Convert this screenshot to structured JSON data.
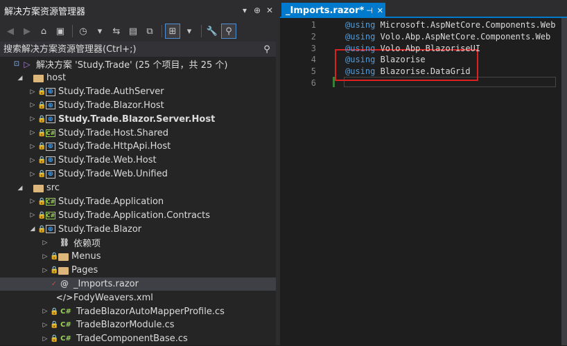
{
  "panel": {
    "title": "解决方案资源管理器",
    "pin_glyph": "▾",
    "pin2_glyph": "⊕",
    "close_glyph": "✕"
  },
  "toolbar": {
    "buttons": [
      "◀",
      "▶",
      "⌂",
      "▣",
      "◷",
      "▾",
      "⇆",
      "▤",
      "⧉",
      "⊞",
      "▾",
      "🔧",
      "⚲"
    ]
  },
  "search": {
    "placeholder": "搜索解决方案资源管理器(Ctrl+;)",
    "icon_glyph": "⚲"
  },
  "tree": [
    {
      "indent": 0,
      "arrow": "",
      "lock": "⊡",
      "icon": "sol",
      "glyph": "▷",
      "label": "解决方案 'Study.Trade' (25 个项目，共 25 个)",
      "bold": false,
      "selected": false
    },
    {
      "indent": 1,
      "arrow": "◢",
      "lock": "",
      "icon": "folder",
      "glyph": "",
      "label": "host",
      "bold": false,
      "selected": false
    },
    {
      "indent": 2,
      "arrow": "▷",
      "lock": "🔒",
      "icon": "web",
      "glyph": "⊕",
      "label": "Study.Trade.AuthServer",
      "bold": false,
      "selected": false
    },
    {
      "indent": 2,
      "arrow": "▷",
      "lock": "🔒",
      "icon": "web",
      "glyph": "⊕",
      "label": "Study.Trade.Blazor.Host",
      "bold": false,
      "selected": false
    },
    {
      "indent": 2,
      "arrow": "▷",
      "lock": "🔒",
      "icon": "web",
      "glyph": "⊕",
      "label": "Study.Trade.Blazor.Server.Host",
      "bold": true,
      "selected": false
    },
    {
      "indent": 2,
      "arrow": "▷",
      "lock": "🔒",
      "icon": "cs",
      "glyph": "C#",
      "label": "Study.Trade.Host.Shared",
      "bold": false,
      "selected": false
    },
    {
      "indent": 2,
      "arrow": "▷",
      "lock": "🔒",
      "icon": "web",
      "glyph": "⊕",
      "label": "Study.Trade.HttpApi.Host",
      "bold": false,
      "selected": false
    },
    {
      "indent": 2,
      "arrow": "▷",
      "lock": "🔒",
      "icon": "web",
      "glyph": "⊕",
      "label": "Study.Trade.Web.Host",
      "bold": false,
      "selected": false
    },
    {
      "indent": 2,
      "arrow": "▷",
      "lock": "🔒",
      "icon": "web",
      "glyph": "⊕",
      "label": "Study.Trade.Web.Unified",
      "bold": false,
      "selected": false
    },
    {
      "indent": 1,
      "arrow": "◢",
      "lock": "",
      "icon": "folder",
      "glyph": "",
      "label": "src",
      "bold": false,
      "selected": false
    },
    {
      "indent": 2,
      "arrow": "▷",
      "lock": "🔒",
      "icon": "cs",
      "glyph": "C#",
      "label": "Study.Trade.Application",
      "bold": false,
      "selected": false
    },
    {
      "indent": 2,
      "arrow": "▷",
      "lock": "🔒",
      "icon": "cs",
      "glyph": "C#",
      "label": "Study.Trade.Application.Contracts",
      "bold": false,
      "selected": false
    },
    {
      "indent": 2,
      "arrow": "◢",
      "lock": "🔒",
      "icon": "web",
      "glyph": "⊕",
      "label": "Study.Trade.Blazor",
      "bold": false,
      "selected": false
    },
    {
      "indent": 3,
      "arrow": "▷",
      "lock": "",
      "icon": "deps",
      "glyph": "⛓",
      "label": "依赖项",
      "bold": false,
      "selected": false
    },
    {
      "indent": 3,
      "arrow": "▷",
      "lock": "🔒",
      "icon": "folder",
      "glyph": "",
      "label": "Menus",
      "bold": false,
      "selected": false
    },
    {
      "indent": 3,
      "arrow": "▷",
      "lock": "🔒",
      "icon": "folder",
      "glyph": "",
      "label": "Pages",
      "bold": false,
      "selected": false
    },
    {
      "indent": 3,
      "arrow": "",
      "lock": "✓",
      "icon": "file",
      "glyph": "@",
      "label": "_Imports.razor",
      "bold": false,
      "selected": true
    },
    {
      "indent": 3,
      "arrow": "",
      "lock": "",
      "icon": "file",
      "glyph": "</>",
      "label": "FodyWeavers.xml",
      "bold": false,
      "selected": false
    },
    {
      "indent": 3,
      "arrow": "▷",
      "lock": "🔒",
      "icon": "csfile",
      "glyph": "C#",
      "label": "TradeBlazorAutoMapperProfile.cs",
      "bold": false,
      "selected": false
    },
    {
      "indent": 3,
      "arrow": "▷",
      "lock": "🔒",
      "icon": "csfile",
      "glyph": "C#",
      "label": "TradeBlazorModule.cs",
      "bold": false,
      "selected": false
    },
    {
      "indent": 3,
      "arrow": "▷",
      "lock": "🔒",
      "icon": "csfile",
      "glyph": "C#",
      "label": "TradeComponentBase.cs",
      "bold": false,
      "selected": false
    }
  ],
  "editor": {
    "tab_label": "_Imports.razor*",
    "tab_pin": "⊣",
    "tab_close": "✕",
    "lines": [
      {
        "num": "1",
        "kw": "@using",
        "rest": " Microsoft.AspNetCore.Components.Web"
      },
      {
        "num": "2",
        "kw": "@using",
        "rest": " Volo.Abp.AspNetCore.Components.Web"
      },
      {
        "num": "3",
        "kw": "@using",
        "rest": " Volo.Abp.BlazoriseUI"
      },
      {
        "num": "4",
        "kw": "@using",
        "rest": " Blazorise"
      },
      {
        "num": "5",
        "kw": "@using",
        "rest": " Blazorise.DataGrid"
      },
      {
        "num": "6",
        "kw": "",
        "rest": ""
      }
    ]
  }
}
